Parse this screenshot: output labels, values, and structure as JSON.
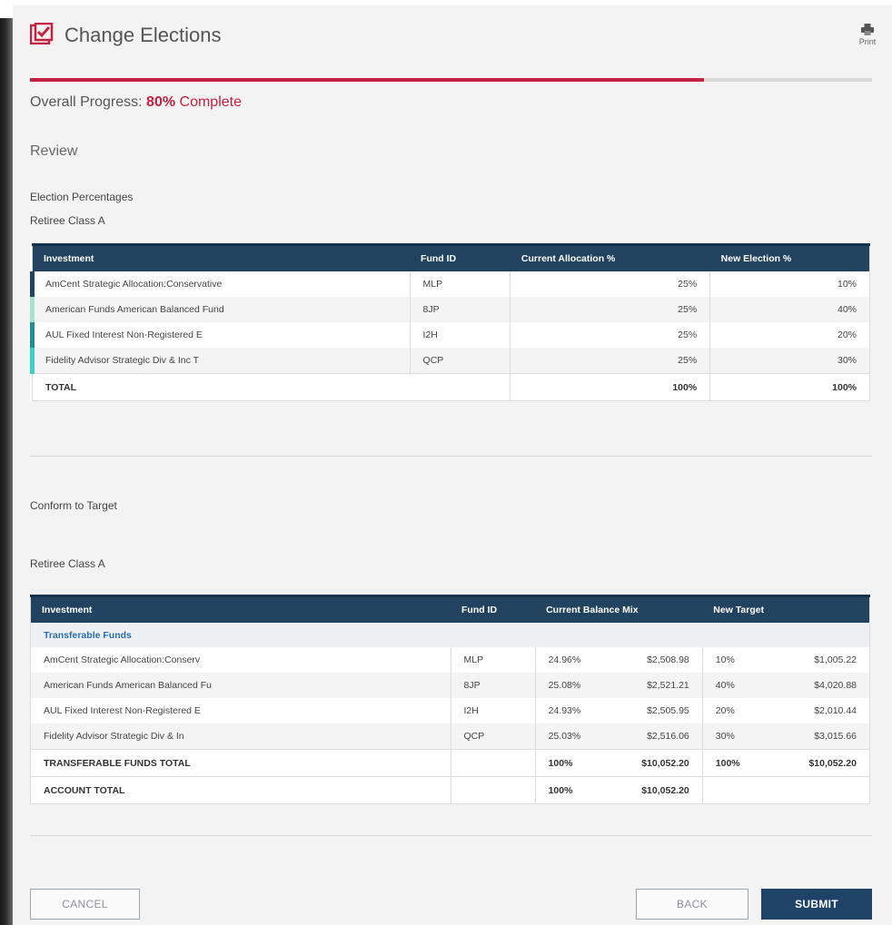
{
  "header": {
    "title": "Change Elections",
    "print_label": "Print"
  },
  "progress": {
    "prefix": "Overall Progress: ",
    "percent_text": "80%",
    "suffix": " Complete",
    "fraction": 0.8
  },
  "review": {
    "title": "Review",
    "election_title": "Election Percentages",
    "class_label": "Retiree Class A",
    "table": {
      "headers": [
        "Investment",
        "Fund ID",
        "Current Allocation %",
        "New Election %"
      ],
      "rows": [
        {
          "investment": "AmCent Strategic Allocation:Conservative",
          "fund_id": "MLP",
          "current": "25%",
          "new": "10%",
          "color": "#22435f"
        },
        {
          "investment": "American Funds American Balanced Fund",
          "fund_id": "8JP",
          "current": "25%",
          "new": "40%",
          "color": "#a8e0d0"
        },
        {
          "investment": "AUL Fixed Interest Non-Registered E",
          "fund_id": "I2H",
          "current": "25%",
          "new": "20%",
          "color": "#1f8e95"
        },
        {
          "investment": "Fidelity Advisor Strategic Div & Inc T",
          "fund_id": "QCP",
          "current": "25%",
          "new": "30%",
          "color": "#3cd0c6"
        }
      ],
      "total": {
        "label": "TOTAL",
        "current": "100%",
        "new": "100%"
      }
    }
  },
  "conform": {
    "title": "Conform to Target",
    "class_label": "Retiree Class A",
    "table": {
      "headers": [
        "Investment",
        "Fund ID",
        "Current Balance Mix",
        "New Target"
      ],
      "subheader": "Transferable Funds",
      "rows": [
        {
          "investment": "AmCent Strategic Allocation:Conserv",
          "fund_id": "MLP",
          "cur_pct": "24.96%",
          "cur_amt": "$2,508.98",
          "new_pct": "10%",
          "new_amt": "$1,005.22"
        },
        {
          "investment": "American Funds American Balanced Fu",
          "fund_id": "8JP",
          "cur_pct": "25.08%",
          "cur_amt": "$2,521.21",
          "new_pct": "40%",
          "new_amt": "$4,020.88"
        },
        {
          "investment": "AUL Fixed Interest Non-Registered E",
          "fund_id": "I2H",
          "cur_pct": "24.93%",
          "cur_amt": "$2,505.95",
          "new_pct": "20%",
          "new_amt": "$2,010.44"
        },
        {
          "investment": "Fidelity Advisor Strategic Div & In",
          "fund_id": "QCP",
          "cur_pct": "25.03%",
          "cur_amt": "$2,516.06",
          "new_pct": "30%",
          "new_amt": "$3,015.66"
        }
      ],
      "transferable_total": {
        "label": "TRANSFERABLE FUNDS TOTAL",
        "cur_pct": "100%",
        "cur_amt": "$10,052.20",
        "new_pct": "100%",
        "new_amt": "$10,052.20"
      },
      "account_total": {
        "label": "ACCOUNT TOTAL",
        "cur_pct": "100%",
        "cur_amt": "$10,052.20"
      }
    }
  },
  "buttons": {
    "cancel": "CANCEL",
    "back": "BACK",
    "submit": "SUBMIT"
  },
  "colors": {
    "accent": "#c4203f",
    "header_bg": "#22435f",
    "primary_button": "#1e4366"
  }
}
